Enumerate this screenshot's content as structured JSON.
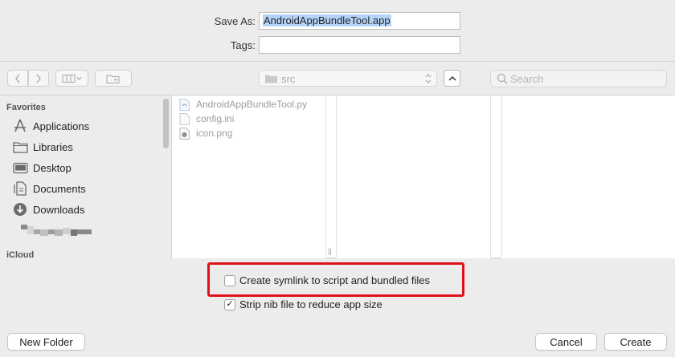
{
  "save_panel": {
    "save_as_label": "Save As:",
    "save_as_value": "AndroidAppBundleTool.app",
    "tags_label": "Tags:",
    "tags_value": ""
  },
  "toolbar": {
    "path_current": "src",
    "search_placeholder": "Search",
    "icons": [
      "chevron-left-icon",
      "chevron-right-icon",
      "column-view-icon",
      "new-folder-icon",
      "folder-icon",
      "chevron-up-icon",
      "search-icon"
    ]
  },
  "sidebar": {
    "favorites_heading": "Favorites",
    "items": [
      {
        "label": "Applications",
        "icon": "applications-icon"
      },
      {
        "label": "Libraries",
        "icon": "folder-icon"
      },
      {
        "label": "Desktop",
        "icon": "desktop-icon"
      },
      {
        "label": "Documents",
        "icon": "documents-icon"
      },
      {
        "label": "Downloads",
        "icon": "downloads-icon"
      }
    ],
    "icloud_heading": "iCloud"
  },
  "files": [
    {
      "name": "AndroidAppBundleTool.py",
      "icon": "python-file-icon"
    },
    {
      "name": "config.ini",
      "icon": "document-icon"
    },
    {
      "name": "icon.png",
      "icon": "image-file-icon"
    }
  ],
  "options": {
    "symlink_label": "Create symlink to script and bundled files",
    "symlink_checked": false,
    "strip_nib_label": "Strip nib file to reduce app size",
    "strip_nib_checked": true,
    "highlight_color": "#e0101a"
  },
  "buttons": {
    "new_folder": "New Folder",
    "cancel": "Cancel",
    "create": "Create"
  }
}
